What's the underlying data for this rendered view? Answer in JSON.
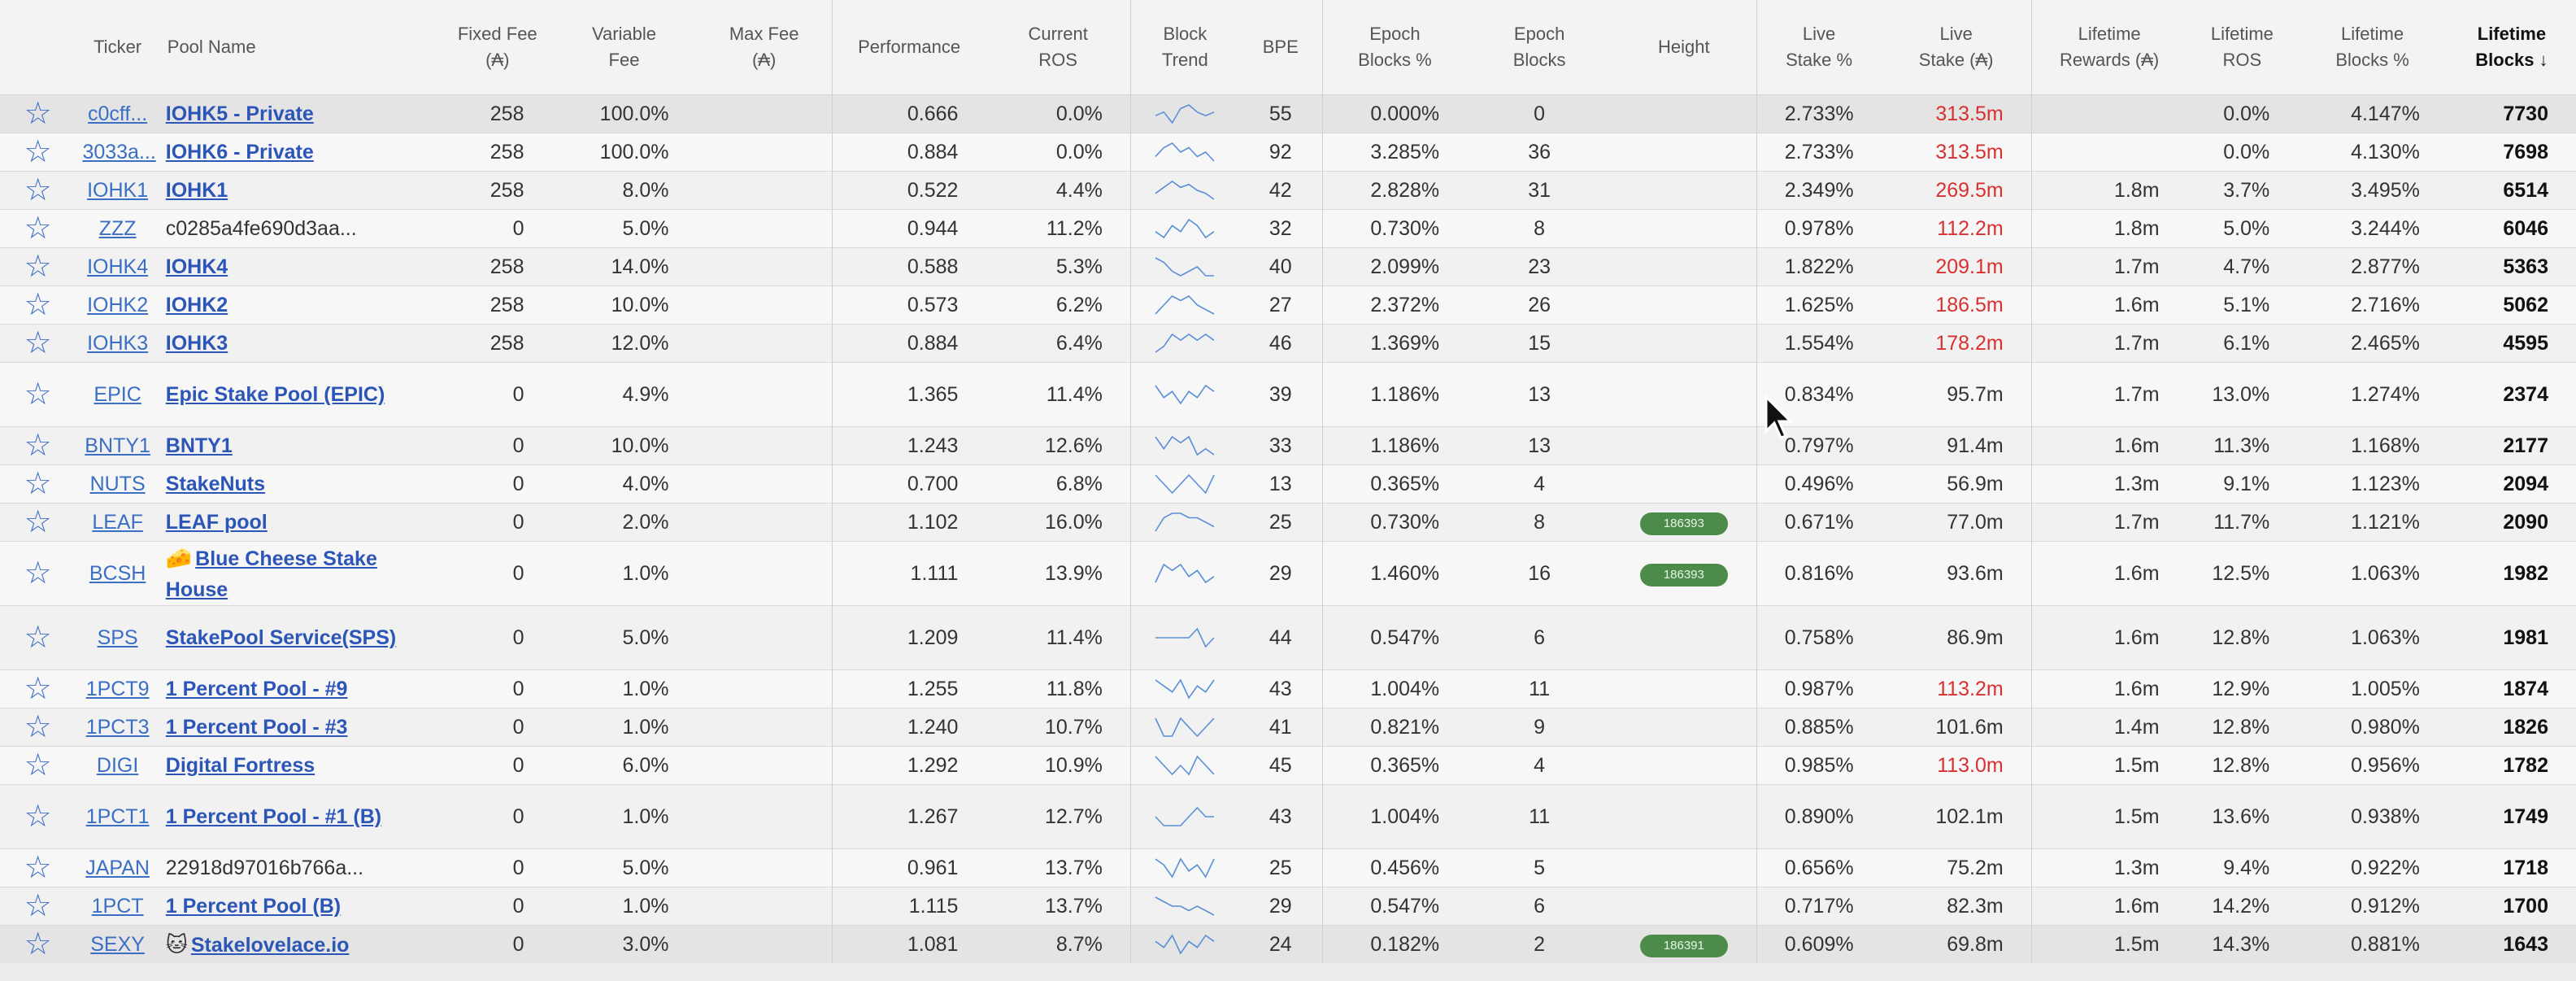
{
  "headers": {
    "ticker": "Ticker",
    "pool_name": "Pool Name",
    "fixed_fee": [
      "Fixed Fee",
      "(₳)"
    ],
    "variable_fee": [
      "Variable",
      "Fee"
    ],
    "max_fee": [
      "Max Fee",
      "(₳)"
    ],
    "performance": "Performance",
    "current_ros": [
      "Current",
      "ROS"
    ],
    "block_trend": [
      "Block",
      "Trend"
    ],
    "bpe": "BPE",
    "epoch_blocks_pct": [
      "Epoch",
      "Blocks %"
    ],
    "epoch_blocks": [
      "Epoch",
      "Blocks"
    ],
    "height": "Height",
    "live_stake_pct": [
      "Live",
      "Stake %"
    ],
    "live_stake": [
      "Live",
      "Stake (₳)"
    ],
    "lifetime_rewards": [
      "Lifetime",
      "Rewards (₳)"
    ],
    "lifetime_ros": [
      "Lifetime",
      "ROS"
    ],
    "lifetime_blocks_pct": [
      "Lifetime",
      "Blocks %"
    ],
    "lifetime_blocks": [
      "Lifetime",
      "Blocks ↓"
    ]
  },
  "colors": {
    "link": "#2c55b8",
    "red": "#d93030",
    "badge": "#4d8b4b"
  },
  "rows": [
    {
      "ticker": "c0cff...",
      "name": "IOHK5 - Private",
      "link": true,
      "fixed": "258",
      "var": "100.0%",
      "perf": "0.666",
      "cros": "0.0%",
      "trend": [
        5,
        6,
        3,
        7,
        8,
        6,
        5,
        6
      ],
      "bpe": "55",
      "ebp": "0.000%",
      "eb": "0",
      "height": "",
      "lsp": "2.733%",
      "ls": "313.5m",
      "lsred": true,
      "lrew": "",
      "lros": "0.0%",
      "lbp": "4.147%",
      "lb": "7730",
      "hl": true
    },
    {
      "ticker": "3033a...",
      "name": "IOHK6 - Private",
      "link": true,
      "fixed": "258",
      "var": "100.0%",
      "perf": "0.884",
      "cros": "0.0%",
      "trend": [
        4,
        6,
        7,
        5,
        6,
        4,
        5,
        3
      ],
      "bpe": "92",
      "ebp": "3.285%",
      "eb": "36",
      "height": "",
      "lsp": "2.733%",
      "ls": "313.5m",
      "lsred": true,
      "lrew": "",
      "lros": "0.0%",
      "lbp": "4.130%",
      "lb": "7698"
    },
    {
      "ticker": "IOHK1",
      "name": "IOHK1",
      "link": true,
      "fixed": "258",
      "var": "8.0%",
      "perf": "0.522",
      "cros": "4.4%",
      "trend": [
        4,
        6,
        8,
        6,
        7,
        5,
        4,
        2
      ],
      "bpe": "42",
      "ebp": "2.828%",
      "eb": "31",
      "height": "",
      "lsp": "2.349%",
      "ls": "269.5m",
      "lsred": true,
      "lrew": "1.8m",
      "lros": "3.7%",
      "lbp": "3.495%",
      "lb": "6514"
    },
    {
      "ticker": "ZZZ",
      "name": "c0285a4fe690d3aa...",
      "link": false,
      "fixed": "0",
      "var": "5.0%",
      "perf": "0.944",
      "cros": "11.2%",
      "trend": [
        5,
        4,
        6,
        5,
        7,
        6,
        4,
        5
      ],
      "bpe": "32",
      "ebp": "0.730%",
      "eb": "8",
      "height": "",
      "lsp": "0.978%",
      "ls": "112.2m",
      "lsred": true,
      "lrew": "1.8m",
      "lros": "5.0%",
      "lbp": "3.244%",
      "lb": "6046"
    },
    {
      "ticker": "IOHK4",
      "name": "IOHK4",
      "link": true,
      "fixed": "258",
      "var": "14.0%",
      "perf": "0.588",
      "cros": "5.3%",
      "trend": [
        8,
        7,
        5,
        4,
        5,
        6,
        4,
        4
      ],
      "bpe": "40",
      "ebp": "2.099%",
      "eb": "23",
      "height": "",
      "lsp": "1.822%",
      "ls": "209.1m",
      "lsred": true,
      "lrew": "1.7m",
      "lros": "4.7%",
      "lbp": "2.877%",
      "lb": "5363"
    },
    {
      "ticker": "IOHK2",
      "name": "IOHK2",
      "link": true,
      "fixed": "258",
      "var": "10.0%",
      "perf": "0.573",
      "cros": "6.2%",
      "trend": [
        4,
        6,
        8,
        7,
        8,
        6,
        5,
        4
      ],
      "bpe": "27",
      "ebp": "2.372%",
      "eb": "26",
      "height": "",
      "lsp": "1.625%",
      "ls": "186.5m",
      "lsred": true,
      "lrew": "1.6m",
      "lros": "5.1%",
      "lbp": "2.716%",
      "lb": "5062"
    },
    {
      "ticker": "IOHK3",
      "name": "IOHK3",
      "link": true,
      "fixed": "258",
      "var": "12.0%",
      "perf": "0.884",
      "cros": "6.4%",
      "trend": [
        4,
        5,
        7,
        6,
        7,
        6,
        7,
        6
      ],
      "bpe": "46",
      "ebp": "1.369%",
      "eb": "15",
      "height": "",
      "lsp": "1.554%",
      "ls": "178.2m",
      "lsred": true,
      "lrew": "1.7m",
      "lros": "6.1%",
      "lbp": "2.465%",
      "lb": "4595"
    },
    {
      "ticker": "EPIC",
      "name": "Epic Stake Pool (EPIC)",
      "link": true,
      "fixed": "0",
      "var": "4.9%",
      "perf": "1.365",
      "cros": "11.4%",
      "trend": [
        6,
        4,
        5,
        3,
        5,
        4,
        6,
        5
      ],
      "bpe": "39",
      "ebp": "1.186%",
      "eb": "13",
      "height": "",
      "lsp": "0.834%",
      "ls": "95.7m",
      "lrew": "1.7m",
      "lros": "13.0%",
      "lbp": "1.274%",
      "lb": "2374",
      "tall": true
    },
    {
      "ticker": "BNTY1",
      "name": "BNTY1",
      "link": true,
      "fixed": "0",
      "var": "10.0%",
      "perf": "1.243",
      "cros": "12.6%",
      "trend": [
        6,
        4,
        6,
        5,
        6,
        3,
        4,
        3
      ],
      "bpe": "33",
      "ebp": "1.186%",
      "eb": "13",
      "height": "",
      "lsp": "0.797%",
      "ls": "91.4m",
      "lrew": "1.6m",
      "lros": "11.3%",
      "lbp": "1.168%",
      "lb": "2177"
    },
    {
      "ticker": "NUTS",
      "name": "StakeNuts",
      "link": true,
      "fixed": "0",
      "var": "4.0%",
      "perf": "0.700",
      "cros": "6.8%",
      "trend": [
        6,
        5,
        4,
        5,
        6,
        5,
        4,
        6
      ],
      "bpe": "13",
      "ebp": "0.365%",
      "eb": "4",
      "height": "",
      "lsp": "0.496%",
      "ls": "56.9m",
      "lrew": "1.3m",
      "lros": "9.1%",
      "lbp": "1.123%",
      "lb": "2094"
    },
    {
      "ticker": "LEAF",
      "name": "LEAF pool",
      "link": true,
      "fixed": "0",
      "var": "2.0%",
      "perf": "1.102",
      "cros": "16.0%",
      "trend": [
        3,
        6,
        7,
        7,
        6,
        6,
        5,
        4
      ],
      "bpe": "25",
      "ebp": "0.730%",
      "eb": "8",
      "height": "186393",
      "lsp": "0.671%",
      "ls": "77.0m",
      "lrew": "1.7m",
      "lros": "11.7%",
      "lbp": "1.121%",
      "lb": "2090"
    },
    {
      "ticker": "BCSH",
      "name": "Blue Cheese Stake House",
      "emoji": "🧀",
      "link": true,
      "fixed": "0",
      "var": "1.0%",
      "perf": "1.111",
      "cros": "13.9%",
      "trend": [
        4,
        7,
        6,
        7,
        5,
        6,
        4,
        5
      ],
      "bpe": "29",
      "ebp": "1.460%",
      "eb": "16",
      "height": "186393",
      "lsp": "0.816%",
      "ls": "93.6m",
      "lrew": "1.6m",
      "lros": "12.5%",
      "lbp": "1.063%",
      "lb": "1982",
      "tall": true
    },
    {
      "ticker": "SPS",
      "name": "StakePool Service(SPS)",
      "link": true,
      "fixed": "0",
      "var": "5.0%",
      "perf": "1.209",
      "cros": "11.4%",
      "trend": [
        5,
        5,
        5,
        5,
        5,
        6,
        4,
        5
      ],
      "bpe": "44",
      "ebp": "0.547%",
      "eb": "6",
      "height": "",
      "lsp": "0.758%",
      "ls": "86.9m",
      "lrew": "1.6m",
      "lros": "12.8%",
      "lbp": "1.063%",
      "lb": "1981",
      "tall": true
    },
    {
      "ticker": "1PCT9",
      "name": "1 Percent Pool - #9",
      "link": true,
      "fixed": "0",
      "var": "1.0%",
      "perf": "1.255",
      "cros": "11.8%",
      "trend": [
        6,
        5,
        4,
        6,
        3,
        5,
        4,
        6
      ],
      "bpe": "43",
      "ebp": "1.004%",
      "eb": "11",
      "height": "",
      "lsp": "0.987%",
      "ls": "113.2m",
      "lsred": true,
      "lrew": "1.6m",
      "lros": "12.9%",
      "lbp": "1.005%",
      "lb": "1874"
    },
    {
      "ticker": "1PCT3",
      "name": "1 Percent Pool - #3",
      "link": true,
      "fixed": "0",
      "var": "1.0%",
      "perf": "1.240",
      "cros": "10.7%",
      "trend": [
        6,
        4,
        4,
        6,
        5,
        4,
        5,
        6
      ],
      "bpe": "41",
      "ebp": "0.821%",
      "eb": "9",
      "height": "",
      "lsp": "0.885%",
      "ls": "101.6m",
      "lrew": "1.4m",
      "lros": "12.8%",
      "lbp": "0.980%",
      "lb": "1826"
    },
    {
      "ticker": "DIGI",
      "name": "Digital Fortress",
      "link": true,
      "fixed": "0",
      "var": "6.0%",
      "perf": "1.292",
      "cros": "10.9%",
      "trend": [
        6,
        5,
        4,
        5,
        4,
        6,
        5,
        4
      ],
      "bpe": "45",
      "ebp": "0.365%",
      "eb": "4",
      "height": "",
      "lsp": "0.985%",
      "ls": "113.0m",
      "lsred": true,
      "lrew": "1.5m",
      "lros": "12.8%",
      "lbp": "0.956%",
      "lb": "1782"
    },
    {
      "ticker": "1PCT1",
      "name": "1 Percent Pool - #1 (B)",
      "link": true,
      "fixed": "0",
      "var": "1.0%",
      "perf": "1.267",
      "cros": "12.7%",
      "trend": [
        5,
        4,
        4,
        4,
        5,
        6,
        5,
        5
      ],
      "bpe": "43",
      "ebp": "1.004%",
      "eb": "11",
      "height": "",
      "lsp": "0.890%",
      "ls": "102.1m",
      "lrew": "1.5m",
      "lros": "13.6%",
      "lbp": "0.938%",
      "lb": "1749",
      "tall": true
    },
    {
      "ticker": "JAPAN",
      "name": "22918d97016b766a...",
      "link": false,
      "fixed": "0",
      "var": "5.0%",
      "perf": "0.961",
      "cros": "13.7%",
      "trend": [
        6,
        5,
        3,
        6,
        4,
        5,
        3,
        6
      ],
      "bpe": "25",
      "ebp": "0.456%",
      "eb": "5",
      "height": "",
      "lsp": "0.656%",
      "ls": "75.2m",
      "lrew": "1.3m",
      "lros": "9.4%",
      "lbp": "0.922%",
      "lb": "1718"
    },
    {
      "ticker": "1PCT",
      "name": "1 Percent Pool (B)",
      "link": true,
      "fixed": "0",
      "var": "1.0%",
      "perf": "1.115",
      "cros": "13.7%",
      "trend": [
        7,
        6,
        5,
        5,
        4,
        5,
        4,
        3
      ],
      "bpe": "29",
      "ebp": "0.547%",
      "eb": "6",
      "height": "",
      "lsp": "0.717%",
      "ls": "82.3m",
      "lrew": "1.6m",
      "lros": "14.2%",
      "lbp": "0.912%",
      "lb": "1700"
    },
    {
      "ticker": "SEXY",
      "name": "Stakelovelace.io",
      "emoji": "🐱",
      "link": true,
      "fixed": "0",
      "var": "3.0%",
      "perf": "1.081",
      "cros": "8.7%",
      "trend": [
        5,
        4,
        6,
        3,
        5,
        4,
        6,
        5
      ],
      "bpe": "24",
      "ebp": "0.182%",
      "eb": "2",
      "height": "186391",
      "lsp": "0.609%",
      "ls": "69.8m",
      "lrew": "1.5m",
      "lros": "14.3%",
      "lbp": "0.881%",
      "lb": "1643",
      "hl": true
    }
  ]
}
